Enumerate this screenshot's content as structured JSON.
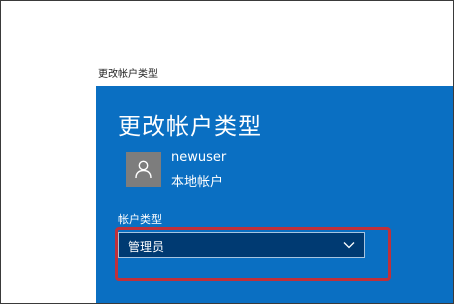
{
  "window": {
    "title": "更改帐户类型"
  },
  "dialog": {
    "heading": "更改帐户类型",
    "user": {
      "name": "newuser",
      "account_kind": "本地帐户",
      "avatar_icon": "user-icon"
    },
    "account_type_field": {
      "label": "帐户类型",
      "selected_value": "管理员",
      "dropdown_icon": "chevron-down-icon"
    }
  },
  "colors": {
    "dialog_background": "#0a6fc2",
    "select_background": "#003a72",
    "highlight_border": "#c0303a",
    "avatar_background": "#7d7d7d"
  }
}
